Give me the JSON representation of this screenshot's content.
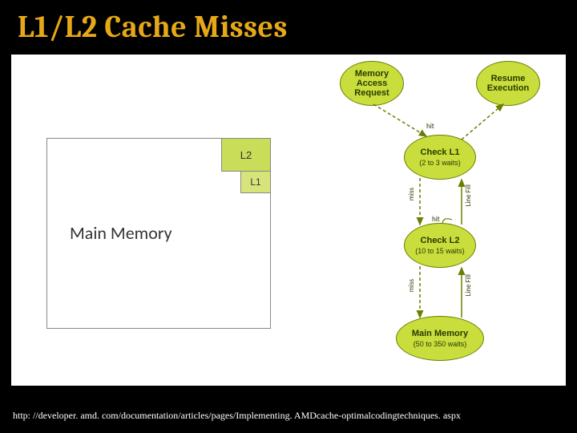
{
  "title": "L1/L2 Cache Misses",
  "footer_url": "http: //developer. amd. com/documentation/articles/pages/Implementing. AMDcache-optimalcodingtechniques. aspx",
  "memory_diagram": {
    "main_label": "Main Memory",
    "l2_label": "L2",
    "l1_label": "L1"
  },
  "flowchart": {
    "request": {
      "name": "Memory Access Request"
    },
    "resume": {
      "name": "Resume Execution"
    },
    "check_l1": {
      "name": "Check L1",
      "sub": "(2 to 3 waits)"
    },
    "check_l2": {
      "name": "Check L2",
      "sub": "(10 to 15 waits)"
    },
    "main_mem": {
      "name": "Main Memory",
      "sub": "(50 to 350 waits)"
    },
    "edges": {
      "hit1": "hit",
      "hit2": "hit",
      "miss1": "miss",
      "miss2": "miss",
      "linefill1": "Line Fill",
      "linefill2": "Line Fill"
    }
  }
}
